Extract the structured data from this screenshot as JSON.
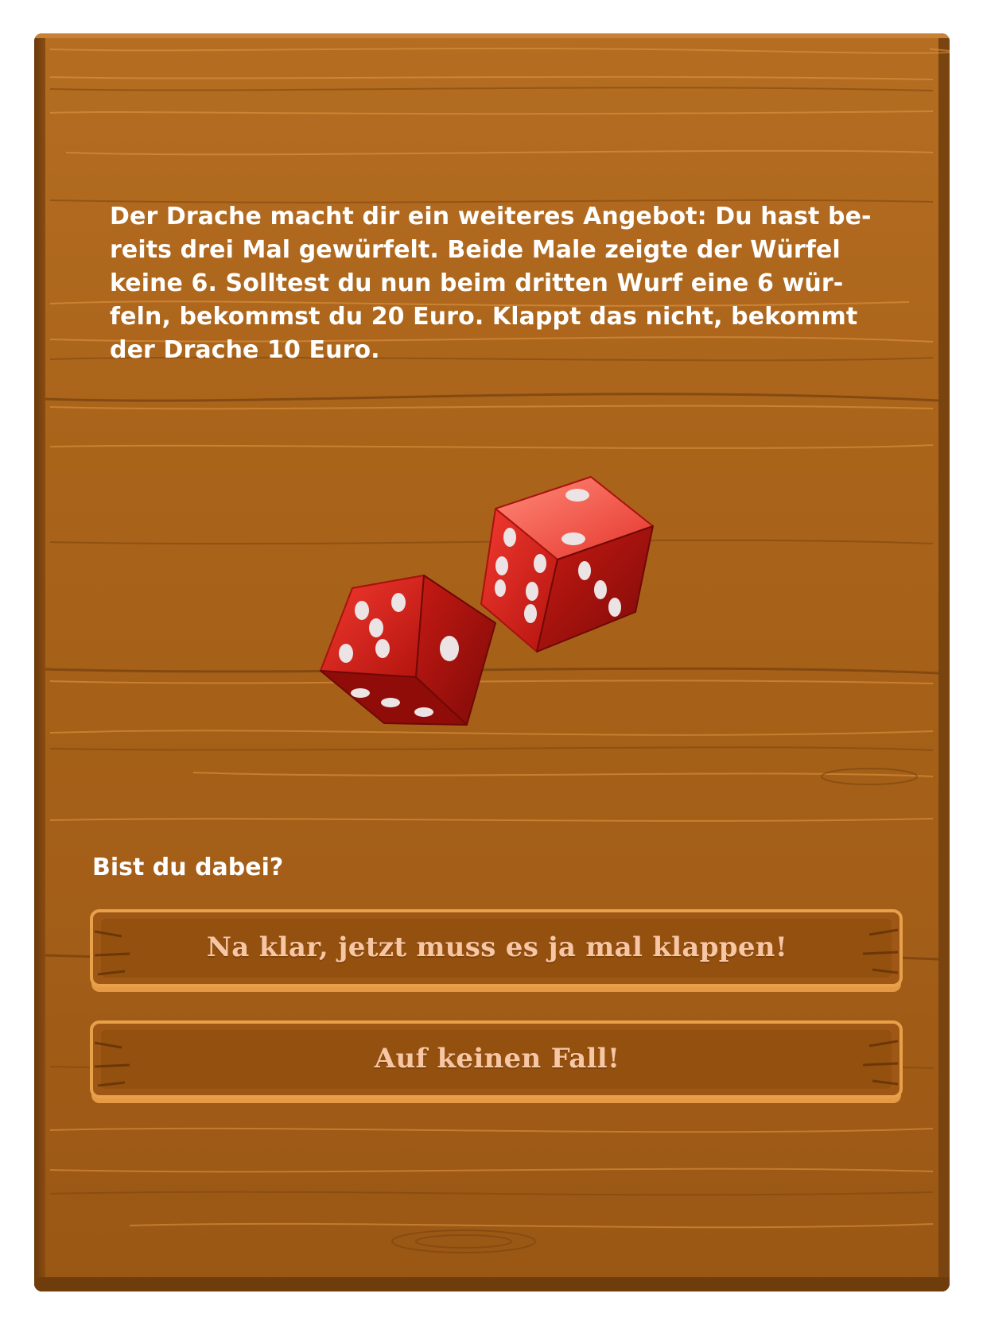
{
  "offer": {
    "text": "Der Drache macht dir ein weiteres Angebot: Du hast be-\nreits drei Mal gewürfelt. Beide Male zeigte der Würfel\nkeine 6. Solltest du nun beim dritten Wurf eine 6 wür-\nfeln, bekommst du 20 Euro. Klappt das nicht, bekommt\nder Drache 10 Euro."
  },
  "illustration": {
    "icon": "dice-icon",
    "dice_color": "#e0201c",
    "pip_color": "#e9e3e3"
  },
  "question": "Bist du dabei?",
  "choices": [
    {
      "label": "Na klar, jetzt muss es ja mal klappen!"
    },
    {
      "label": "Auf keinen Fall!"
    }
  ],
  "colors": {
    "wood": "#a86219",
    "wood_dark": "#6e3d0b",
    "wood_highlight": "#e8a04a",
    "button_text": "#f7c7a5",
    "text": "#ffffff"
  }
}
